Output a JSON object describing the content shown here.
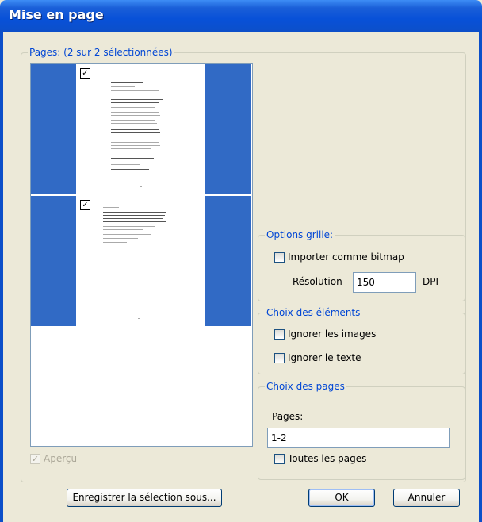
{
  "window": {
    "title": "Mise en page"
  },
  "pages_group": {
    "legend": "Pages: (2 sur 2 sélectionnées)",
    "preview_checkbox": {
      "label": "Aperçu",
      "checked": true,
      "disabled": true
    }
  },
  "grid_options": {
    "legend": "Options grille:",
    "import_bitmap": {
      "label": "Importer comme bitmap",
      "checked": false
    },
    "resolution_label": "Résolution",
    "resolution_value": "150",
    "resolution_unit": "DPI"
  },
  "elements": {
    "legend": "Choix des éléments",
    "ignore_images": {
      "label": "Ignorer les images",
      "checked": false
    },
    "ignore_text": {
      "label": "Ignorer le texte",
      "checked": false
    }
  },
  "pages_choice": {
    "legend": "Choix des pages",
    "pages_label": "Pages:",
    "pages_value": "1-2",
    "all_pages": {
      "label": "Toutes les pages",
      "checked": false
    }
  },
  "buttons": {
    "save_selection": "Enregistrer la sélection sous...",
    "ok": "OK",
    "cancel": "Annuler"
  },
  "colors": {
    "selection": "#316ac5",
    "legend": "#0046d5",
    "titlebar": "#0c4fc9"
  }
}
